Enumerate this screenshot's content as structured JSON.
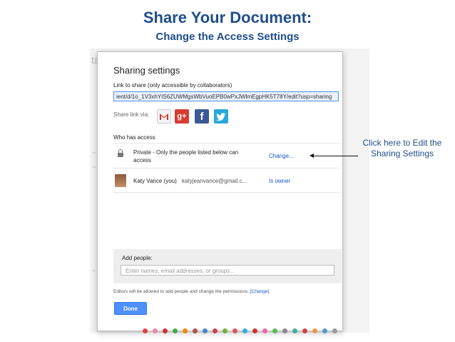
{
  "slide": {
    "title": "Share Your Document:",
    "subtitle": "Change the Access Settings"
  },
  "dialog": {
    "title": "Sharing settings",
    "link_label": "Link to share (only accessible by collaborators)",
    "link_value": "ient/d/1o_1V3xhYIS6ZUWMgsWbVuoEPB0wPxJWlmEgpHK5T78Y/edit?usp=sharing",
    "share_via_label": "Share link via:",
    "share_icons": [
      "gmail-icon",
      "google-plus-icon",
      "facebook-icon",
      "twitter-icon"
    ],
    "who_has_access": "Who has access",
    "access_rows": [
      {
        "icon": "lock-icon",
        "text": "Private - Only the people listed below can access",
        "action": "Change..."
      },
      {
        "icon": "avatar",
        "name": "Katy Vance (you)",
        "email": "katyjeanvance@gmail.c...",
        "role": "Is owner"
      }
    ],
    "add_people_label": "Add people:",
    "add_people_placeholder": "Enter names, email addresses, or groups...",
    "editors_note": "Editors will be allowed to add people and change the permissions.",
    "editors_change": "[Change]",
    "done_label": "Done"
  },
  "annotation": {
    "text": "Click here to Edit the Sharing Settings"
  },
  "colors": {
    "title": "#1f4e8c",
    "link": "#1155cc",
    "done_button": "#4d90fe",
    "gplus": "#d73d32",
    "facebook": "#3b5998",
    "twitter": "#2aa9e0"
  }
}
